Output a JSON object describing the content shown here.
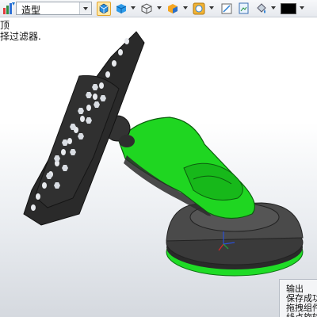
{
  "toolbar": {
    "mode_label": "造型",
    "color_swatch": "#000000"
  },
  "viewport": {
    "hint_line1": "顶",
    "hint_line2": "择过滤器."
  },
  "output_panel": {
    "title": "输出",
    "lines": [
      "保存成功",
      "拖拽组件",
      "线点旋转"
    ]
  },
  "colors": {
    "model_green": "#19d21e",
    "model_dark": "#2b2b2b"
  }
}
